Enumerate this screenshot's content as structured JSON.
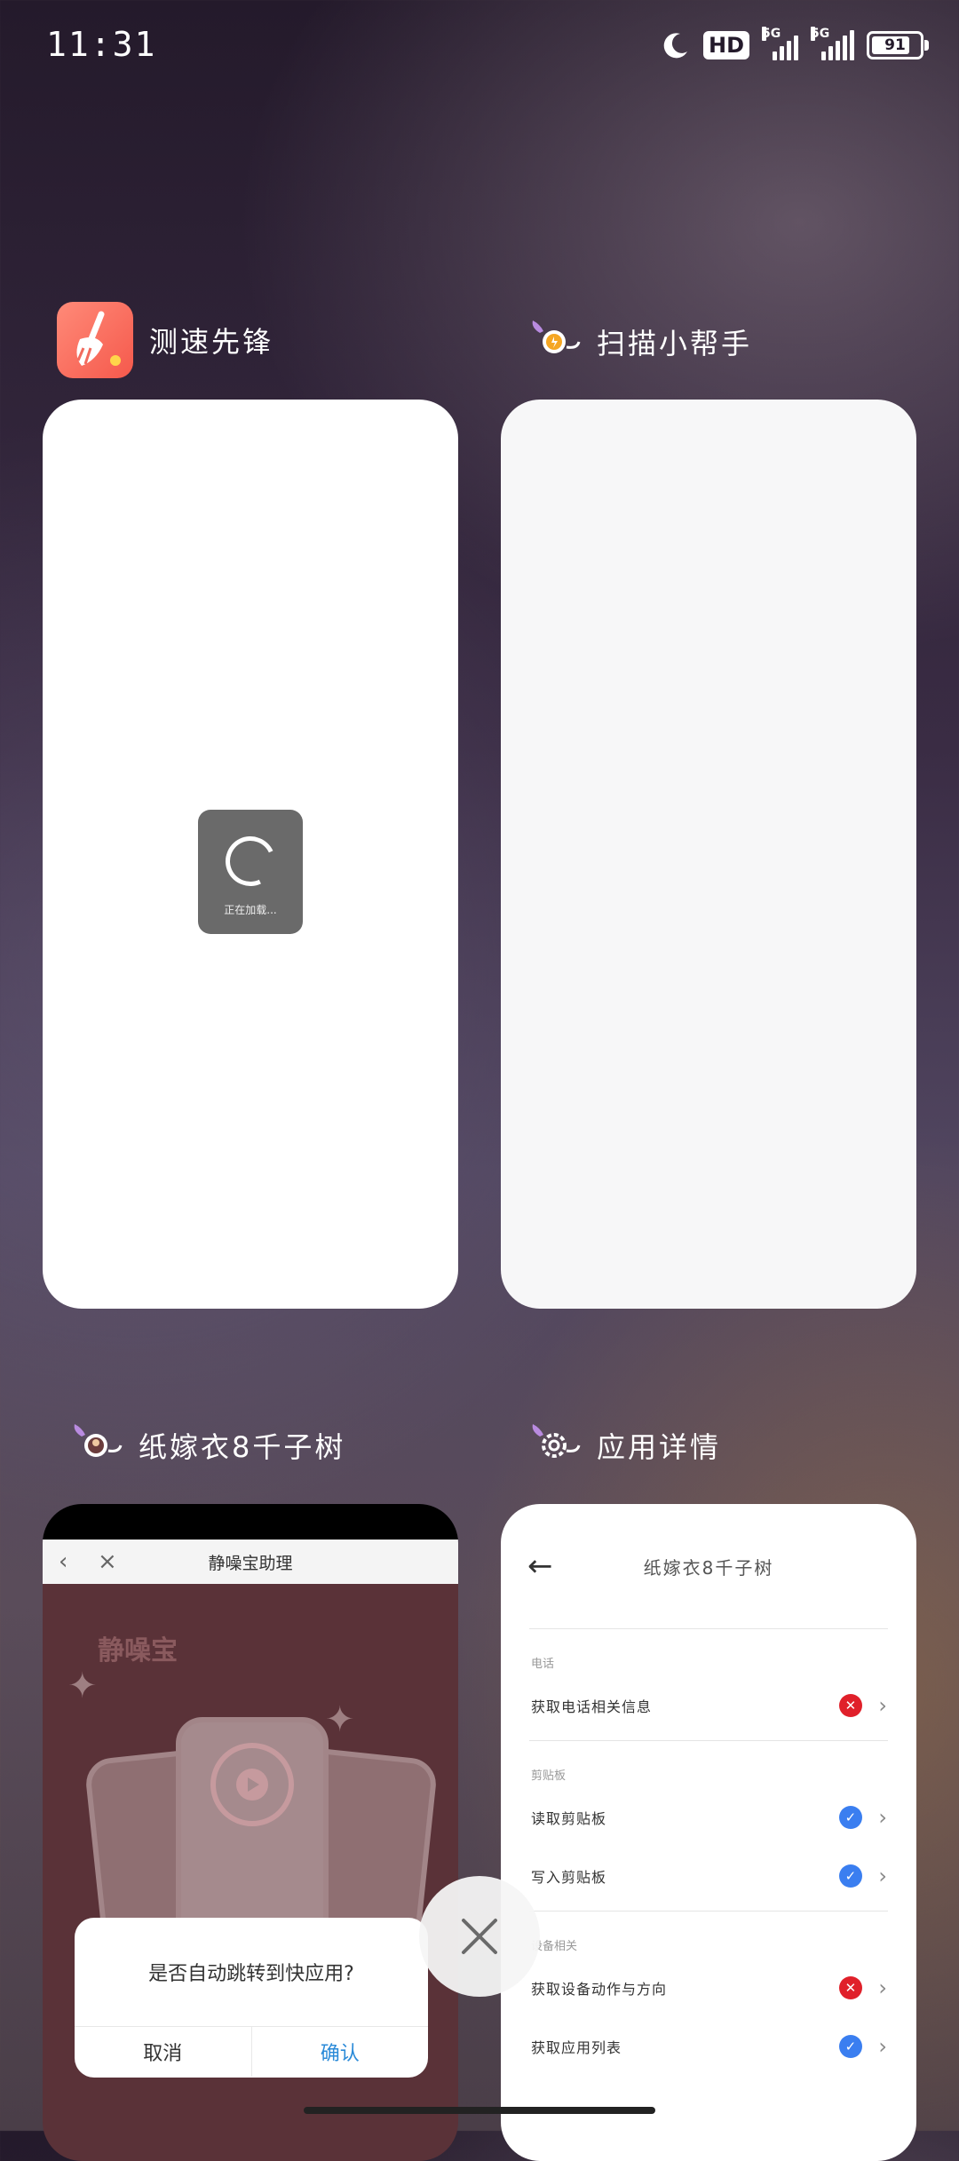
{
  "status_bar": {
    "time": "11:31",
    "hd_label": "HD",
    "network_1": "5G",
    "network_2": "5G",
    "battery_level": "91",
    "battery_fraction": 0.91
  },
  "apps": [
    {
      "name": "测速先锋",
      "icon": "broom-icon",
      "icon_color": "#f5594c",
      "loading_text": "正在加载..."
    },
    {
      "name": "扫描小帮手",
      "icon": "quick-app-icon"
    },
    {
      "name": "纸嫁衣8千子树",
      "icon": "quick-app-icon",
      "page_title": "静噪宝助理",
      "brand": "静噪宝"
    },
    {
      "name": "应用详情",
      "icon": "quick-app-settings-icon",
      "page_title": "纸嫁衣8千子树",
      "sections": [
        {
          "title": "电话",
          "rows": [
            {
              "label": "获取电话相关信息",
              "status": "denied"
            }
          ]
        },
        {
          "title": "剪贴板",
          "rows": [
            {
              "label": "读取剪贴板",
              "status": "allowed"
            },
            {
              "label": "写入剪贴板",
              "status": "allowed"
            }
          ]
        },
        {
          "title": "设备相关",
          "rows": [
            {
              "label": "获取设备动作与方向",
              "status": "denied"
            },
            {
              "label": "获取应用列表",
              "status": "allowed"
            }
          ]
        }
      ]
    }
  ],
  "dialog": {
    "message": "是否自动跳转到快应用?",
    "cancel_label": "取消",
    "confirm_label": "确认"
  },
  "colors": {
    "denied": "#e0202a",
    "allowed": "#3a7ef0",
    "confirm": "#2a8ad8"
  }
}
